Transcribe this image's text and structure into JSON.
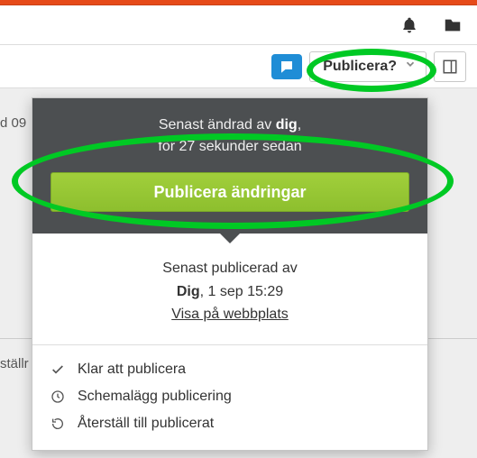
{
  "toolbar": {
    "publish_dropdown_label": "Publicera?"
  },
  "left_fragments": {
    "line1": "d 09",
    "line2": "ställr"
  },
  "popover": {
    "dark": {
      "line1_prefix": "Senast ändrad av ",
      "line1_bold": "dig",
      "line1_suffix": ",",
      "line2": "för 27 sekunder sedan",
      "button": "Publicera ändringar"
    },
    "mid": {
      "line1": "Senast publicerad av",
      "line2_bold": "Dig",
      "line2_rest": ", 1 sep 15:29",
      "link": "Visa på webbplats"
    },
    "options": {
      "ready": "Klar att publicera",
      "schedule": "Schemalägg publicering",
      "revert": "Återställ till publicerat"
    }
  }
}
